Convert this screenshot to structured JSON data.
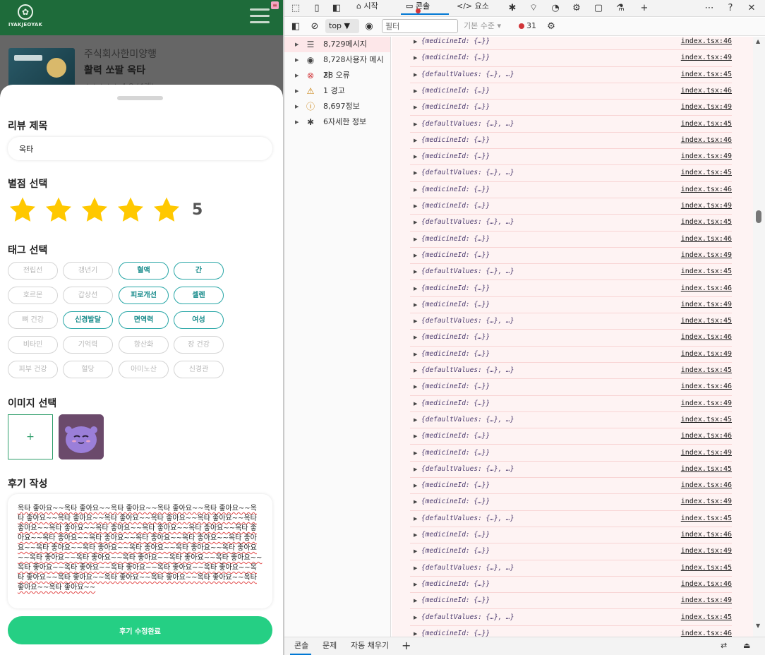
{
  "app": {
    "logo_text": "IYAKJEOYAK",
    "product": {
      "maker": "주식회사한미양행",
      "name": "활력 쏘팔 옥타",
      "rating": "★★★★★ 4.8 (4개)"
    },
    "review_form": {
      "title_label": "리뷰 제목",
      "title_value": "옥타",
      "rating_label": "별점 선택",
      "rating_value": "5",
      "tag_label": "태그 선택",
      "tags": [
        {
          "label": "전립선",
          "selected": false
        },
        {
          "label": "갱년기",
          "selected": false
        },
        {
          "label": "혈액",
          "selected": true
        },
        {
          "label": "간",
          "selected": true
        },
        {
          "label": "호르몬",
          "selected": false
        },
        {
          "label": "갑상선",
          "selected": false
        },
        {
          "label": "피로개선",
          "selected": true
        },
        {
          "label": "셀렌",
          "selected": true
        },
        {
          "label": "뼈 건강",
          "selected": false
        },
        {
          "label": "신경발달",
          "selected": true
        },
        {
          "label": "면역력",
          "selected": true
        },
        {
          "label": "여성",
          "selected": true
        },
        {
          "label": "비타민",
          "selected": false
        },
        {
          "label": "기억력",
          "selected": false
        },
        {
          "label": "항산화",
          "selected": false
        },
        {
          "label": "장 건강",
          "selected": false
        },
        {
          "label": "피부 건강",
          "selected": false
        },
        {
          "label": "혈당",
          "selected": false
        },
        {
          "label": "아미노산",
          "selected": false
        },
        {
          "label": "신경관",
          "selected": false
        }
      ],
      "image_label": "이미지 선택",
      "add_image_symbol": "+",
      "review_label": "후기 작성",
      "review_text": "옥타 좋아요~~옥타 좋아요~~옥타 좋아요~~옥타 좋아요~~옥타 좋아요~~옥타 좋아요~~옥타 좋아요~~옥타 좋아요~~옥타 좋아요~~옥타 좋아요~~옥타 좋아요~~옥타 좋아요~~옥타 좋아요~~옥타 좋아요~~옥타 좋아요~~옥타 좋아요~~옥타 좋아요~~옥타 좋아요~~옥타 좋아요~~옥타 좋아요~~옥타 좋아요~~옥타 좋아요~~옥타 좋아요~~옥타 좋아요~~옥타 좋아요~~옥타 좋아요~~옥타 좋아요~~옥타 좋아요~~옥타 좋아요~~옥타 좋아요~~옥타 좋아요~~옥타 좋아요~~옥타 좋아요~~옥타 좋아요~~옥타 좋아요~~옥타 좋아요~~옥타 좋아요~~옥타 좋아요~~옥타 좋아요~~옥타 좋아요~~옥타 좋아요~~옥타 좋아요~~옥타 좋아요~~",
      "submit_label": "후기 수정완료"
    }
  },
  "devtools": {
    "tabs": {
      "welcome": "시작",
      "console": "콘솔",
      "elements": "요소"
    },
    "toolbar": {
      "context": "top",
      "filter_placeholder": "필터",
      "levels": "기본 수준",
      "issues_count": "31"
    },
    "sidebar": [
      {
        "label": "8,729메시지",
        "icon": "list-icon",
        "selected": true
      },
      {
        "label": "8,728사용자 메시지",
        "icon": "user-icon",
        "selected": false
      },
      {
        "label": "28 오류",
        "icon": "error-icon",
        "selected": false
      },
      {
        "label": "1 경고",
        "icon": "warning-icon",
        "selected": false
      },
      {
        "label": "8,697정보",
        "icon": "info-icon",
        "selected": false
      },
      {
        "label": "6자세한 정보",
        "icon": "bug-icon",
        "selected": false
      }
    ],
    "log_rows": [
      {
        "text": "{medicineId: {…}}",
        "source": "index.tsx:46"
      },
      {
        "text": "{medicineId: {…}}",
        "source": "index.tsx:49"
      },
      {
        "text": "{defaultValues: {…}, …}",
        "source": "index.tsx:45"
      },
      {
        "text": "{medicineId: {…}}",
        "source": "index.tsx:46"
      },
      {
        "text": "{medicineId: {…}}",
        "source": "index.tsx:49"
      },
      {
        "text": "{defaultValues: {…}, …}",
        "source": "index.tsx:45"
      },
      {
        "text": "{medicineId: {…}}",
        "source": "index.tsx:46"
      },
      {
        "text": "{medicineId: {…}}",
        "source": "index.tsx:49"
      },
      {
        "text": "{defaultValues: {…}, …}",
        "source": "index.tsx:45"
      },
      {
        "text": "{medicineId: {…}}",
        "source": "index.tsx:46"
      },
      {
        "text": "{medicineId: {…}}",
        "source": "index.tsx:49"
      },
      {
        "text": "{defaultValues: {…}, …}",
        "source": "index.tsx:45"
      },
      {
        "text": "{medicineId: {…}}",
        "source": "index.tsx:46"
      },
      {
        "text": "{medicineId: {…}}",
        "source": "index.tsx:49"
      },
      {
        "text": "{defaultValues: {…}, …}",
        "source": "index.tsx:45"
      },
      {
        "text": "{medicineId: {…}}",
        "source": "index.tsx:46"
      },
      {
        "text": "{medicineId: {…}}",
        "source": "index.tsx:49"
      },
      {
        "text": "{defaultValues: {…}, …}",
        "source": "index.tsx:45"
      },
      {
        "text": "{medicineId: {…}}",
        "source": "index.tsx:46"
      },
      {
        "text": "{medicineId: {…}}",
        "source": "index.tsx:49"
      },
      {
        "text": "{defaultValues: {…}, …}",
        "source": "index.tsx:45"
      },
      {
        "text": "{medicineId: {…}}",
        "source": "index.tsx:46"
      },
      {
        "text": "{medicineId: {…}}",
        "source": "index.tsx:49"
      },
      {
        "text": "{defaultValues: {…}, …}",
        "source": "index.tsx:45"
      },
      {
        "text": "{medicineId: {…}}",
        "source": "index.tsx:46"
      },
      {
        "text": "{medicineId: {…}}",
        "source": "index.tsx:49"
      },
      {
        "text": "{defaultValues: {…}, …}",
        "source": "index.tsx:45"
      },
      {
        "text": "{medicineId: {…}}",
        "source": "index.tsx:46"
      },
      {
        "text": "{medicineId: {…}}",
        "source": "index.tsx:49"
      },
      {
        "text": "{defaultValues: {…}, …}",
        "source": "index.tsx:45"
      },
      {
        "text": "{medicineId: {…}}",
        "source": "index.tsx:46"
      },
      {
        "text": "{medicineId: {…}}",
        "source": "index.tsx:49"
      },
      {
        "text": "{defaultValues: {…}, …}",
        "source": "index.tsx:45"
      },
      {
        "text": "{medicineId: {…}}",
        "source": "index.tsx:46"
      },
      {
        "text": "{medicineId: {…}}",
        "source": "index.tsx:49"
      },
      {
        "text": "{defaultValues: {…}, …}",
        "source": "index.tsx:45"
      },
      {
        "text": "{medicineId: {…}}",
        "source": "index.tsx:46"
      }
    ],
    "drawer": {
      "console": "콘솔",
      "issues": "문제",
      "autofill": "자동 채우기"
    }
  },
  "colors": {
    "header_green": "#1e6b3a",
    "submit_green": "#25cf84",
    "tag_selected": "#27a6a6",
    "star_yellow": "#ffc800",
    "devtools_accent": "#0078d4",
    "error_red": "#d13438"
  }
}
